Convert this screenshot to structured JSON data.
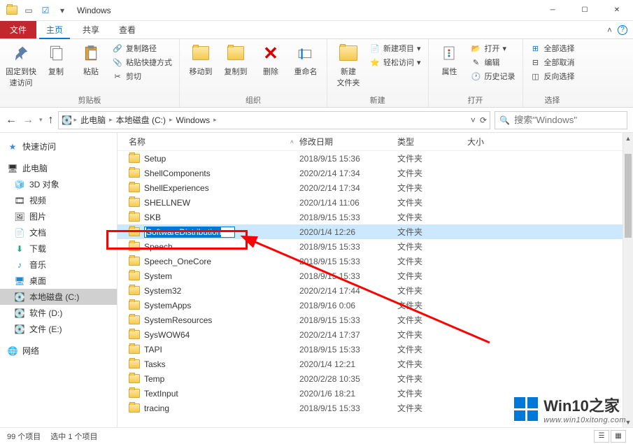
{
  "window": {
    "title": "Windows"
  },
  "ribbon_tabs": {
    "file": "文件",
    "home": "主页",
    "share": "共享",
    "view": "查看"
  },
  "ribbon": {
    "clipboard": {
      "pin": "固定到快\n速访问",
      "copy": "复制",
      "paste": "粘贴",
      "copy_path": "复制路径",
      "paste_shortcut": "粘贴快捷方式",
      "cut": "剪切",
      "label": "剪贴板"
    },
    "organize": {
      "move_to": "移动到",
      "copy_to": "复制到",
      "delete": "删除",
      "rename": "重命名",
      "label": "组织"
    },
    "new": {
      "new_folder": "新建\n文件夹",
      "new_item": "新建项目",
      "easy_access": "轻松访问",
      "label": "新建"
    },
    "open": {
      "properties": "属性",
      "open": "打开",
      "edit": "编辑",
      "history": "历史记录",
      "label": "打开"
    },
    "select": {
      "select_all": "全部选择",
      "select_none": "全部取消",
      "invert": "反向选择",
      "label": "选择"
    }
  },
  "breadcrumb": {
    "pc": "此电脑",
    "drive": "本地磁盘 (C:)",
    "folder": "Windows"
  },
  "search": {
    "placeholder": "搜索\"Windows\""
  },
  "columns": {
    "name": "名称",
    "date": "修改日期",
    "type": "类型",
    "size": "大小"
  },
  "type_folder": "文件夹",
  "sidebar": {
    "quick": "快速访问",
    "pc": "此电脑",
    "obj3d": "3D 对象",
    "video": "视频",
    "pictures": "图片",
    "documents": "文档",
    "downloads": "下载",
    "music": "音乐",
    "desktop": "桌面",
    "drive_c": "本地磁盘 (C:)",
    "drive_d": "软件 (D:)",
    "drive_e": "文件 (E:)",
    "network": "网络"
  },
  "files": [
    {
      "name": "Setup",
      "date": "2018/9/15 15:36"
    },
    {
      "name": "ShellComponents",
      "date": "2020/2/14 17:34"
    },
    {
      "name": "ShellExperiences",
      "date": "2020/2/14 17:34"
    },
    {
      "name": "SHELLNEW",
      "date": "2020/1/14 11:06"
    },
    {
      "name": "SKB",
      "date": "2018/9/15 15:33"
    },
    {
      "name": "SoftwareDistribution",
      "date": "2020/1/4 12:26",
      "selected": true,
      "renaming": true
    },
    {
      "name": "Speech",
      "date": "2018/9/15 15:33"
    },
    {
      "name": "Speech_OneCore",
      "date": "2018/9/15 15:33"
    },
    {
      "name": "System",
      "date": "2018/9/15 15:33"
    },
    {
      "name": "System32",
      "date": "2020/2/14 17:44"
    },
    {
      "name": "SystemApps",
      "date": "2018/9/16 0:06"
    },
    {
      "name": "SystemResources",
      "date": "2018/9/15 15:33"
    },
    {
      "name": "SysWOW64",
      "date": "2020/2/14 17:37"
    },
    {
      "name": "TAPI",
      "date": "2018/9/15 15:33"
    },
    {
      "name": "Tasks",
      "date": "2020/1/4 12:21"
    },
    {
      "name": "Temp",
      "date": "2020/2/28 10:35"
    },
    {
      "name": "TextInput",
      "date": "2020/1/6 18:21"
    },
    {
      "name": "tracing",
      "date": "2018/9/15 15:33"
    }
  ],
  "status": {
    "total": "99 个项目",
    "selected": "选中 1 个项目"
  },
  "watermark": {
    "title": "Win10之家",
    "url": "www.win10xitong.com"
  }
}
